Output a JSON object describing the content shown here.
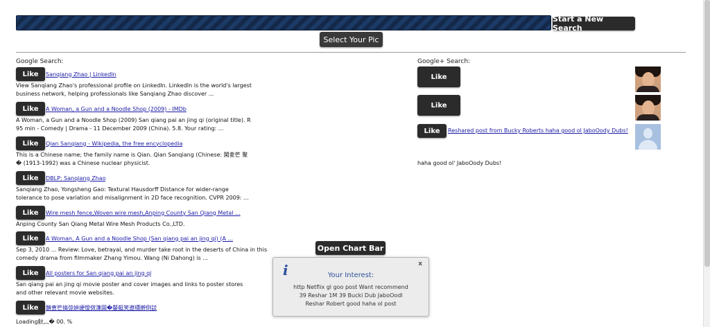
{
  "toolbar": {
    "new_search_label": "Start a New Search",
    "select_pic_label": "Select Your Pic"
  },
  "google": {
    "label": "Google Search:",
    "like_label": "Like",
    "results": [
      {
        "title": "Sanqiang Zhao | LinkedIn",
        "snippet": "View Sanqiang Zhao's professional profile on LinkedIn. LinkedIn is the world's largest business network, helping professionals like Sanqiang Zhao discover ..."
      },
      {
        "title": "A Woman, a Gun and a Noodle Shop (2009) - IMDb",
        "snippet": "A Woman, a Gun and a Noodle Shop (2009) San qiang pai an jing qi (original title). R 95 min - Comedy | Drama - 11 December 2009 (China). 5.8. Your rating: ..."
      },
      {
        "title": "Qian Sanqiang - Wikipedia, the free encyclopedia",
        "snippet": "This is a Chinese name; the family name is Qian. Qian Sanqiang (Chinese: 闖夌笀 聚� (1913-1992) was a Chinese nuclear physicist."
      },
      {
        "title": "DBLP: Sanqiang Zhao",
        "snippet": "Sanqiang Zhao, Yongsheng Gao: Textural Hausdorff Distance for wider-range tolerance to pose variation and misalignment in 2D face recognition. CVPR 2009: ..."
      },
      {
        "title": "Wire mesh fence,Woven wire mesh,Anping County San Qiang Metal ...",
        "snippet": "Anping County San Qiang Metal Wire Mesh Products Co.,LTD."
      },
      {
        "title": "A Woman, A Gun and a Noodle Shop (San qiang pai an jing qi) (A ...",
        "snippet": "Sep 3, 2010 ... Review: Love, betrayal, and murder take root in the deserts of China in this comedy drama from filmmaker Zhang Yimou. Wang (Ni Dahong) is ..."
      },
      {
        "title": "All posters for San qiang pai an jing qi",
        "snippet": "San qiang pai an jing qi movie poster and cover images and links to poster stores and other relevant movie websites."
      },
      {
        "title": "鎖叀笀搞弶姘绠懓傚溓図�嫠艇笑遼櫹擀倒訤",
        "snippet": ""
      }
    ],
    "loading_text": "Loading鈥︹� 00. %"
  },
  "gplus": {
    "label": "Google+ Search:",
    "like_label": "Like",
    "post_link": "Reshared post from Bucky Roberts haha good ol JaboOody Dubs!",
    "post_text": "haha good ol' JaboOody Dubs!"
  },
  "chart_button_label": "Open Chart Bar",
  "popup": {
    "icon": "info-icon",
    "close": "x",
    "title": "Your Interest:",
    "lines": [
      "http Netflix gl goo post Want recommend",
      "39 Reshar 1M 39 Bucki Dub JaboOodl",
      "Reshar Robert good haha ol post"
    ]
  }
}
